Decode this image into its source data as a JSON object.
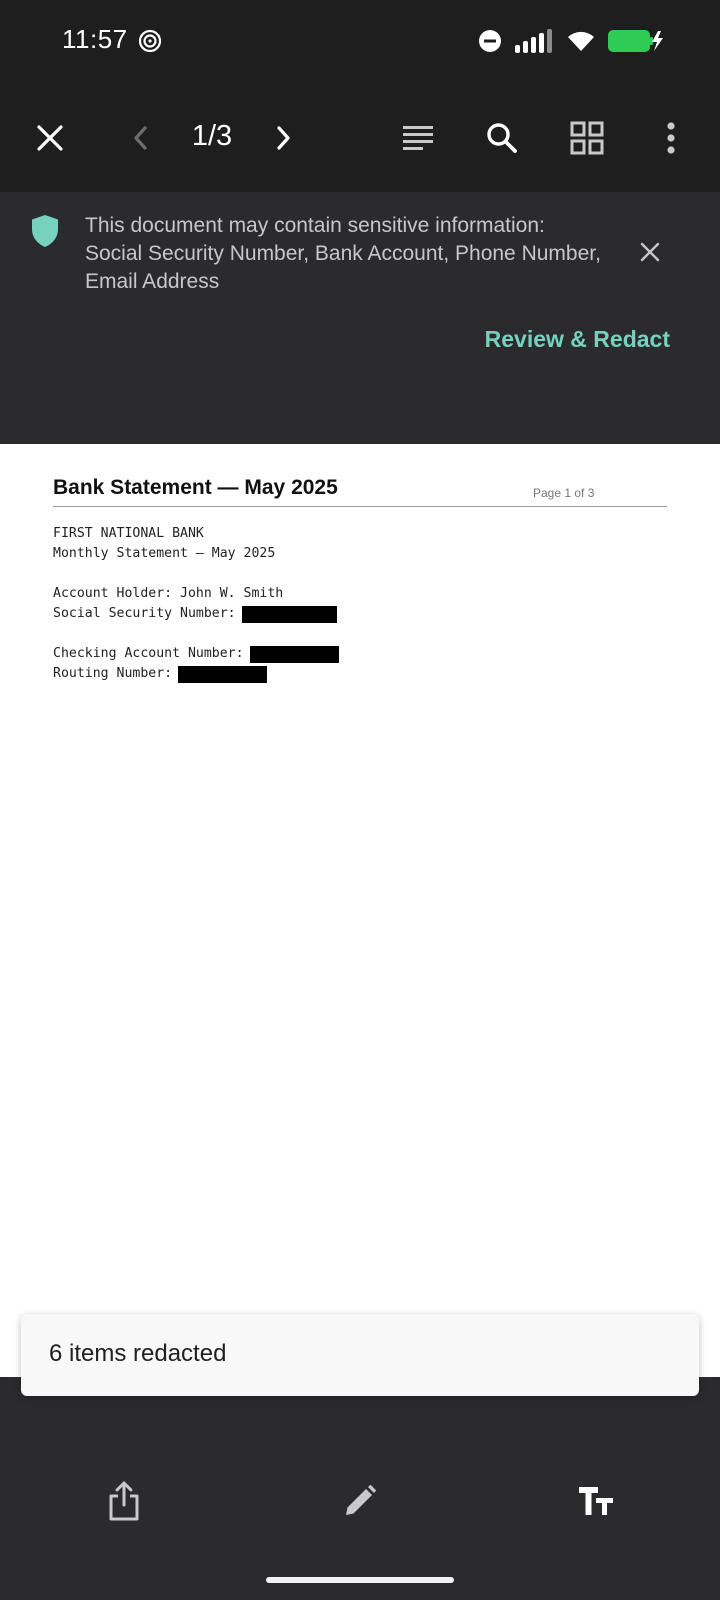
{
  "status_bar": {
    "time": "11:57"
  },
  "toolbar": {
    "page_indicator": "1/3",
    "icons": [
      "close-icon",
      "chevron-left-icon",
      "chevron-right-icon",
      "text-view-icon",
      "search-icon",
      "grid-view-icon",
      "more-vert-icon"
    ]
  },
  "banner": {
    "message": "This document may contain sensitive information: Social Security Number, Bank Account, Phone Number, Email Address",
    "action_label": "Review & Redact",
    "accent_color": "#76d1bf"
  },
  "document": {
    "title": "Bank Statement — May 2025",
    "page_label": "Page 1 of 3",
    "bank_name": "FIRST NATIONAL BANK",
    "statement_line": "Monthly Statement — May 2025",
    "account_holder": "Account Holder: John W. Smith",
    "ssn_label": "Social Security Number:",
    "checking_label": "Checking Account Number:",
    "routing_label": "Routing Number:"
  },
  "snackbar": {
    "message": "6 items redacted"
  },
  "bottom_bar": {
    "icons": [
      "share-icon",
      "edit-pencil-icon",
      "text-size-icon"
    ]
  }
}
